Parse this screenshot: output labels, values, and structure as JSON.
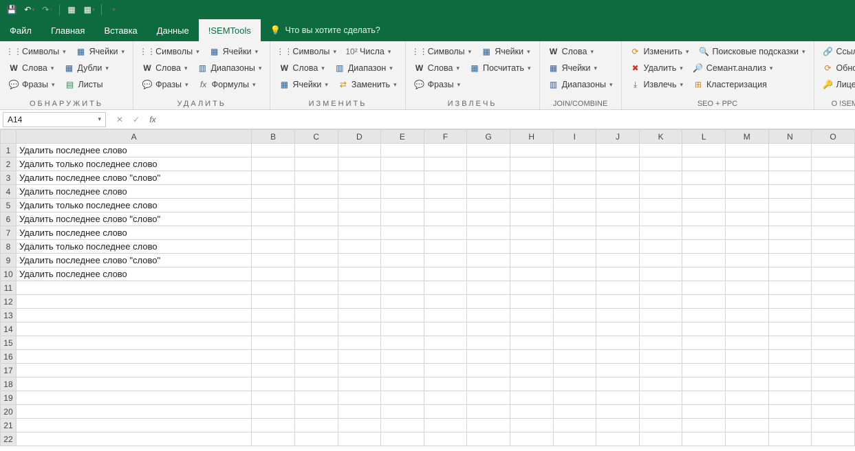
{
  "qat": {
    "save": "💾",
    "undo": "↶",
    "redo": "↷",
    "custom1": "⊞",
    "custom2": "⊞"
  },
  "tabs": {
    "file": "Файл",
    "home": "Главная",
    "insert": "Вставка",
    "data": "Данные",
    "semtools": "!SEMTools",
    "tellme": "Что вы хотите сделать?"
  },
  "ribbon": {
    "g1": {
      "title": "ОБНАРУЖИТЬ",
      "symbols": "Символы",
      "cells": "Ячейки",
      "words": "Слова",
      "dupes": "Дубли",
      "phrases": "Фразы",
      "sheets": "Листы"
    },
    "g2": {
      "title": "УДАЛИТЬ",
      "symbols": "Символы",
      "cells": "Ячейки",
      "words": "Слова",
      "ranges": "Диапазоны",
      "phrases": "Фразы",
      "formulas": "Формулы"
    },
    "g3": {
      "title": "ИЗМЕНИТЬ",
      "symbols": "Символы",
      "numbers": "Числа",
      "words": "Слова",
      "range": "Диапазон",
      "cells": "Ячейки",
      "replace": "Заменить"
    },
    "g4": {
      "title": "ИЗВЛЕЧЬ",
      "symbols": "Символы",
      "cells": "Ячейки",
      "words": "Слова",
      "count": "Посчитать",
      "phrases": "Фразы"
    },
    "g5": {
      "title": "Join/Combine",
      "words": "Слова",
      "cells": "Ячейки",
      "ranges": "Диапазоны"
    },
    "g6": {
      "title": "SEO + PPC",
      "change": "Изменить",
      "hints": "Поисковые подсказки",
      "delete": "Удалить",
      "semant": "Семант.анализ",
      "extract": "Извлечь",
      "cluster": "Кластеризация"
    },
    "g7": {
      "title": "о !SEMTools",
      "links": "Ссылки",
      "update": "Обновление",
      "license": "Лицензия"
    }
  },
  "fbar": {
    "cellref": "A14"
  },
  "columns": [
    "A",
    "B",
    "C",
    "D",
    "E",
    "F",
    "G",
    "H",
    "I",
    "J",
    "K",
    "L",
    "M",
    "N",
    "O"
  ],
  "rows": [
    1,
    2,
    3,
    4,
    5,
    6,
    7,
    8,
    9,
    10,
    11,
    12,
    13,
    14,
    15,
    16,
    17,
    18,
    19,
    20,
    21,
    22
  ],
  "cellsA": {
    "1": "Удалить последнее слово",
    "2": "Удалить только последнее слово",
    "3": "Удалить последнее слово \"слово\"",
    "4": "Удалить последнее слово",
    "5": "Удалить только последнее слово",
    "6": "Удалить последнее слово \"слово\"",
    "7": "Удалить последнее слово",
    "8": "Удалить только последнее слово",
    "9": "Удалить последнее слово \"слово\"",
    "10": "Удалить последнее слово"
  }
}
